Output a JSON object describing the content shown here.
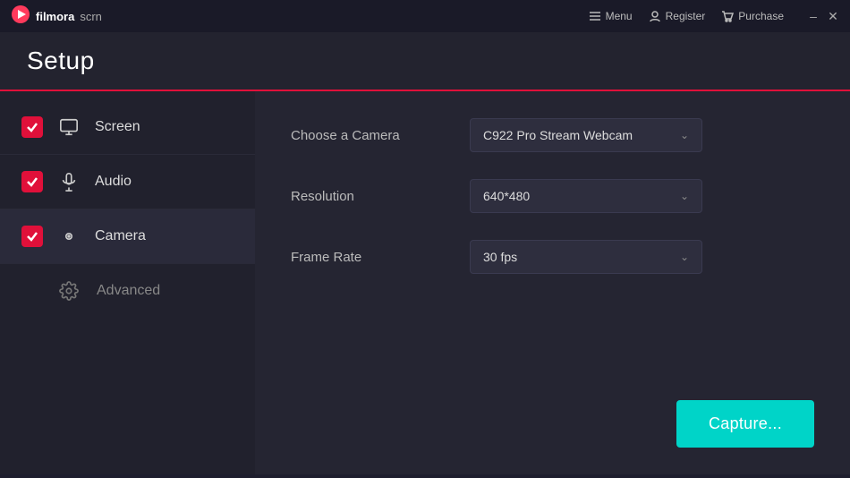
{
  "app": {
    "logo_icon": "▶",
    "logo_name": "filmora",
    "logo_scrn": "scrn",
    "title": "Setup"
  },
  "titlebar": {
    "menu_label": "Menu",
    "register_label": "Register",
    "purchase_label": "Purchase"
  },
  "sidebar": {
    "items": [
      {
        "id": "screen",
        "label": "Screen",
        "checked": true
      },
      {
        "id": "audio",
        "label": "Audio",
        "checked": true
      },
      {
        "id": "camera",
        "label": "Camera",
        "checked": true
      }
    ],
    "advanced_label": "Advanced"
  },
  "settings": {
    "camera_label": "Choose a Camera",
    "camera_value": "C922 Pro Stream Webcam",
    "resolution_label": "Resolution",
    "resolution_value": "640*480",
    "framerate_label": "Frame Rate",
    "framerate_value": "30 fps"
  },
  "capture_button": "Capture..."
}
